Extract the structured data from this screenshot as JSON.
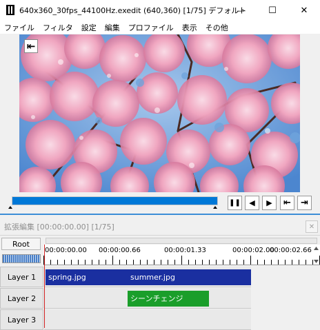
{
  "window": {
    "title": "640x360_30fps_44100Hz.exedit (640,360)  [1/75]  デフォルト",
    "minimize_glyph": "—",
    "maximize_glyph": "☐",
    "close_glyph": "✕"
  },
  "menu": [
    "ファイル",
    "フィルタ",
    "設定",
    "編集",
    "プロファイル",
    "表示",
    "その他"
  ],
  "preview": {
    "image_subject": "cherry-blossom",
    "back_glyph": "⇤"
  },
  "playback": {
    "position_fraction": 1.0,
    "controls": [
      {
        "name": "pause",
        "glyph": "❚❚"
      },
      {
        "name": "prev-frame",
        "glyph": "◀"
      },
      {
        "name": "next-frame",
        "glyph": "▶"
      },
      {
        "name": "to-start",
        "glyph": "⇤"
      },
      {
        "name": "to-end",
        "glyph": "⇥"
      }
    ]
  },
  "timeline": {
    "title": "拡張編集 [00:00:00.00] [1/75]",
    "close_glyph": "✕",
    "root_label": "Root",
    "ruler_labels": [
      "00:00:00.00",
      "00:00:00.66",
      "00:00:01.33",
      "00:00:02.00",
      "00:00:02.66"
    ],
    "layers": [
      "Layer 1",
      "Layer 2",
      "Layer 3"
    ],
    "clips": [
      {
        "label": "spring.jpg",
        "layer": 1,
        "color": "#1a2fa0"
      },
      {
        "label": "summer.jpg",
        "layer": 1,
        "color": "#1a2fa0"
      },
      {
        "label": "シーンチェンジ",
        "layer": 2,
        "color": "#1a9e2a"
      }
    ]
  },
  "colors": {
    "accent": "#0078d7",
    "clip_blue": "#1a2fa0",
    "clip_green": "#1a9e2a",
    "cursor": "#d02020"
  }
}
